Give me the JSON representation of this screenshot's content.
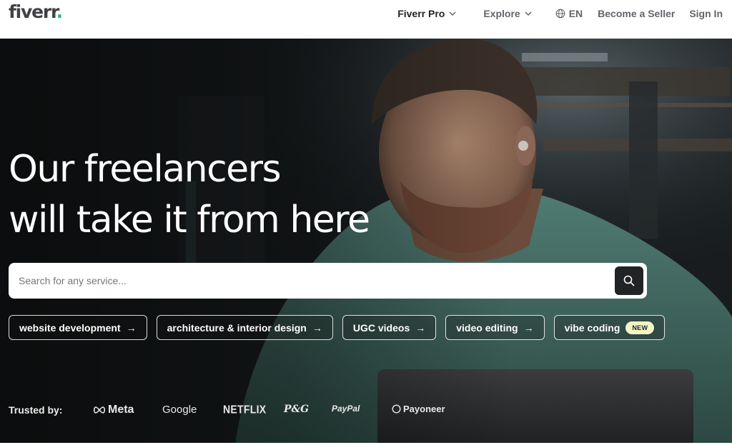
{
  "brand": {
    "logo": "fiverr",
    "logo_dot": ".",
    "accent": "#1dbf73"
  },
  "nav": {
    "items": [
      {
        "label": "Fiverr Pro",
        "icon": "chevron-down-icon"
      },
      {
        "label": "Explore",
        "icon": "chevron-down-icon"
      },
      {
        "label": "EN",
        "icon": "globe-icon"
      },
      {
        "label": "Become a Seller"
      },
      {
        "label": "Sign In"
      }
    ]
  },
  "hero": {
    "headline_line1": "Our freelancers",
    "headline_line2": "will take it from here",
    "search": {
      "placeholder": "Search for any service...",
      "value": "",
      "button_icon": "search-icon"
    },
    "chips": [
      {
        "label": "website development",
        "arrow": "→"
      },
      {
        "label": "architecture & interior design",
        "arrow": "→"
      },
      {
        "label": "UGC videos",
        "arrow": "→"
      },
      {
        "label": "video editing",
        "arrow": "→"
      },
      {
        "label": "vibe coding",
        "badge": "NEW"
      }
    ],
    "trusted": {
      "label": "Trusted by:",
      "brands": [
        "Meta",
        "Google",
        "NETFLIX",
        "P&G",
        "PayPal",
        "Payoneer"
      ]
    }
  },
  "colors": {
    "text_dark": "#404145",
    "search_button": "#222325",
    "badge_bg": "#f2f5c5"
  }
}
